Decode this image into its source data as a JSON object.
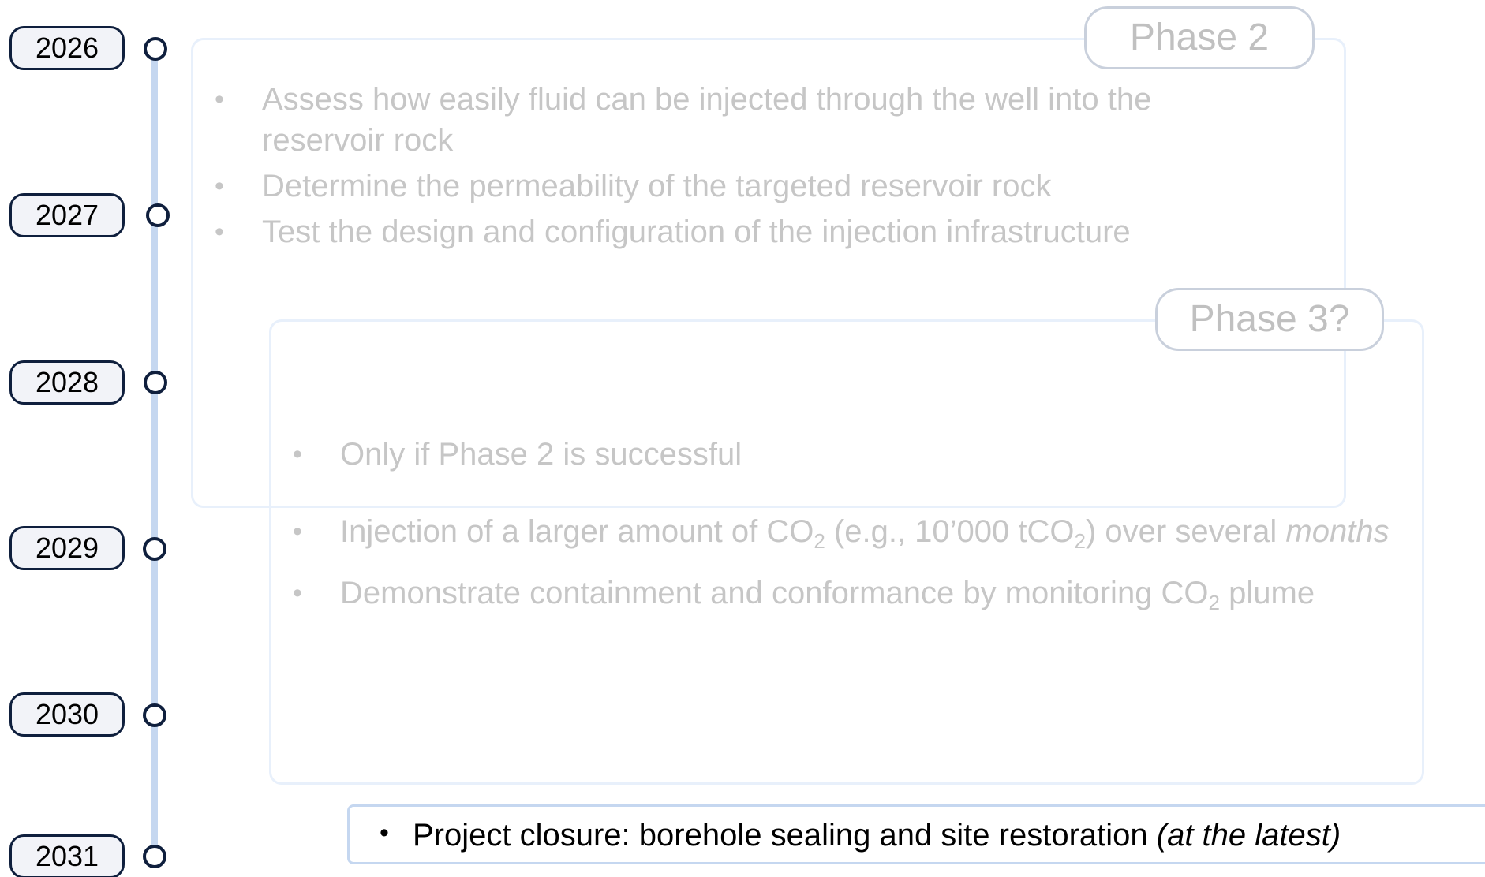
{
  "timeline": {
    "years": [
      "2026",
      "2027",
      "2028",
      "2029",
      "2030",
      "2031"
    ]
  },
  "phase2": {
    "label": "Phase 2",
    "bullets": [
      "Assess how easily fluid can be injected through the well into the reservoir rock",
      "Determine the permeability of the targeted reservoir rock",
      "Test the design and configuration of the injection infrastructure"
    ]
  },
  "phase3": {
    "label": "Phase 3?",
    "bullet1": "Only if Phase 2 is successful",
    "bullet2": {
      "pre": "Injection of a larger amount of CO",
      "sub1": "2",
      "mid": " (e.g., 10’000 tCO",
      "sub2": "2",
      "post": ") over several ",
      "italic": "months"
    },
    "bullet3": {
      "pre": "Demonstrate containment and conformance by monitoring CO",
      "sub": "2",
      "post": " plume"
    }
  },
  "closure": {
    "text": "Project closure: borehole sealing and site restoration ",
    "italic": "(at the latest)"
  },
  "colors": {
    "axis": "#c5d7f0",
    "outline_dark": "#0f1f3d",
    "faded_text": "#c6c6c6",
    "pill_border": "#c9d0dc"
  }
}
